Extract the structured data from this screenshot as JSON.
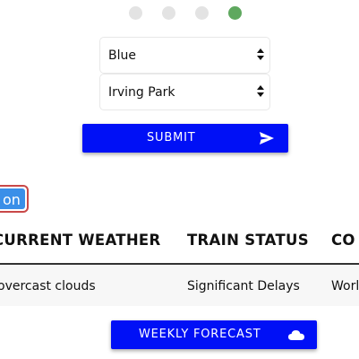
{
  "stepper": {
    "total": 4,
    "active_index": 3,
    "active_color": "#5fa85f",
    "inactive_color": "#e3e3e3"
  },
  "form": {
    "color_select": {
      "value": "Blue"
    },
    "station_select": {
      "value": "Irving Park"
    },
    "submit": {
      "label": "SUBMIT",
      "icon": "send-icon"
    }
  },
  "partial_button": {
    "label": "on"
  },
  "table": {
    "headers": [
      "CURRENT WEATHER",
      "TRAIN STATUS",
      "CO"
    ],
    "row": [
      "overcast clouds",
      "Significant Delays",
      "Worl"
    ]
  },
  "weekly_forecast": {
    "label": "WEEKLY FORECAST",
    "icon": "cloud-icon"
  },
  "colors": {
    "primary_button": "#0010f6",
    "partial_button_fill": "#3a8fe8",
    "partial_button_border": "#c94848"
  }
}
